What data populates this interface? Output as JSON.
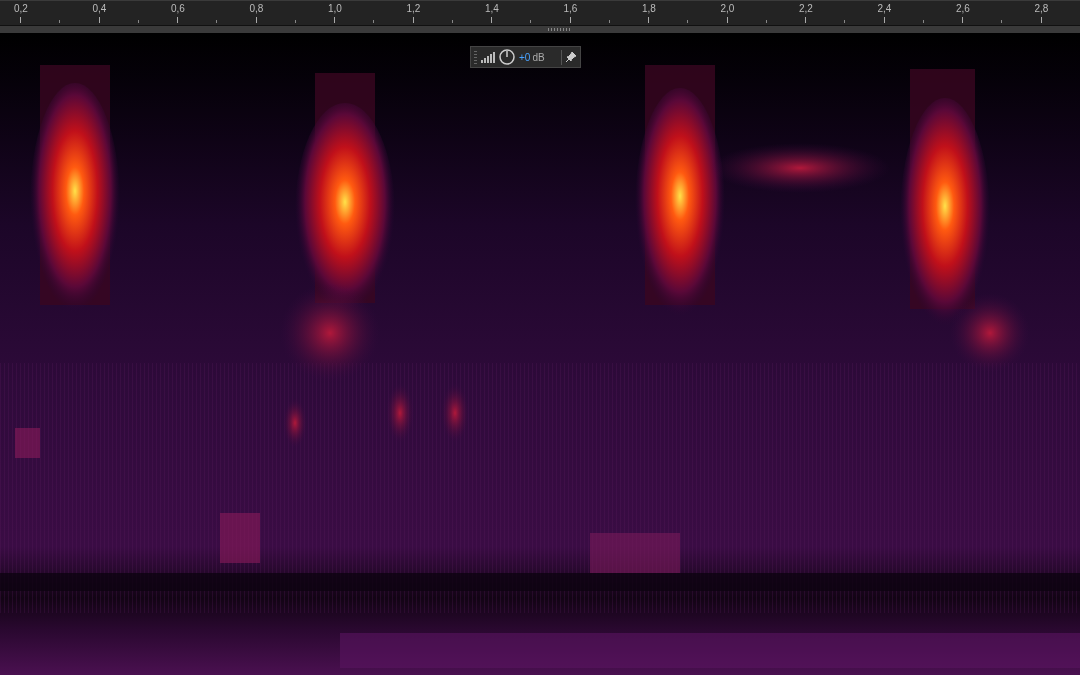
{
  "ruler": {
    "labels": [
      "0,2",
      "0,4",
      "0,6",
      "0,8",
      "1,0",
      "1,2",
      "1,4",
      "1,6",
      "1,8",
      "2,0",
      "2,2",
      "2,4",
      "2,6",
      "2,8"
    ]
  },
  "hud": {
    "value": "+0",
    "unit": "dB"
  }
}
